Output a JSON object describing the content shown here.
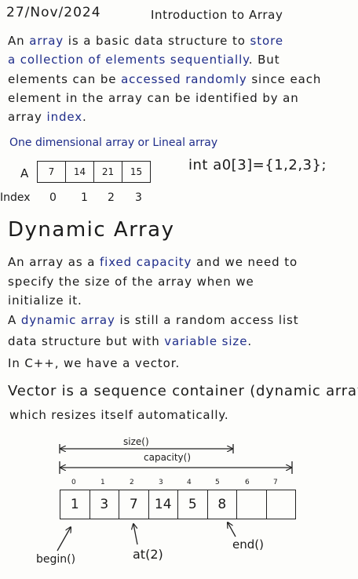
{
  "header": {
    "date": "27/Nov/2024",
    "title": "Introduction to Array"
  },
  "intro": {
    "l1a": "An ",
    "l1b": "array",
    "l1c": " is a basic data structure to ",
    "l1d": "store",
    "l2a": "a collection of elements sequentially",
    "l2b": ". But",
    "l3a": "elements can be ",
    "l3b": "accessed randomly",
    "l3c": " since each",
    "l4": "element in the array can be identified by an",
    "l5a": "array ",
    "l5b": "index",
    "l5c": "."
  },
  "one_d": {
    "label": "One dimensional array or Lineal array",
    "array_name": "A",
    "values": [
      "7",
      "14",
      "21",
      "15"
    ],
    "index_label": "Index",
    "indices": [
      "0",
      "1",
      "2",
      "3"
    ],
    "declaration": "int a0[3]={1,2,3};"
  },
  "dynamic": {
    "title": "Dynamic Array",
    "p1a": "An array as a ",
    "p1b": "fixed capacity",
    "p1c": " and we need to",
    "p2": "specify the size of the array when we",
    "p3": "initialize it.",
    "p4a": "A ",
    "p4b": "dynamic array",
    "p4c": " is still a random access list",
    "p5a": "data structure but with ",
    "p5b": "variable size",
    "p5c": ".",
    "p6": "In C++, we have a vector."
  },
  "vector": {
    "line1": "Vector is a sequence container (dynamic array)",
    "line2": "which resizes itself automatically.",
    "size_label": "size()",
    "capacity_label": "capacity()",
    "indices": [
      "0",
      "1",
      "2",
      "3",
      "4",
      "5",
      "6",
      "7"
    ],
    "values": [
      "1",
      "3",
      "7",
      "14",
      "5",
      "8",
      "",
      ""
    ],
    "begin_label": "begin()",
    "at_label": "at(2)",
    "end_label": "end()"
  }
}
